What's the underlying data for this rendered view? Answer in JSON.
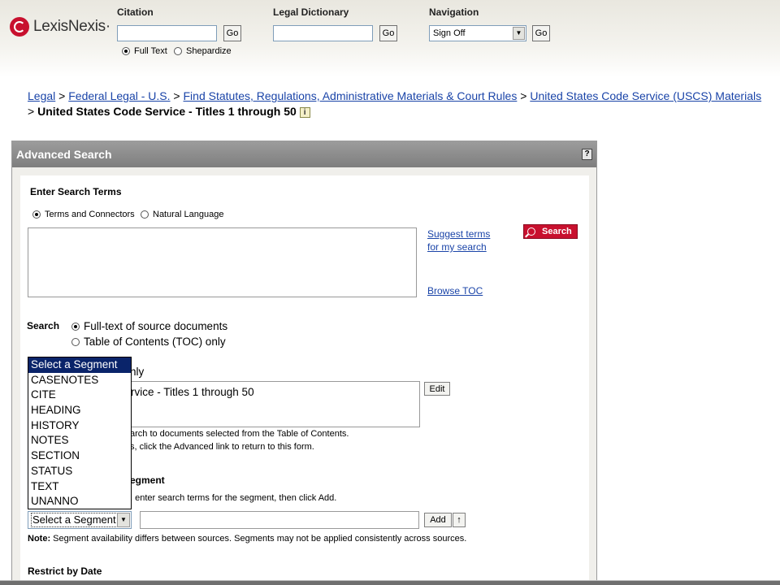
{
  "header": {
    "logo_text": "LexisNexis·",
    "citation": {
      "label": "Citation",
      "go": "Go",
      "value": ""
    },
    "citation_options": [
      {
        "label": "Full Text",
        "checked": true
      },
      {
        "label": "Shepardize",
        "checked": false
      }
    ],
    "dictionary": {
      "label": "Legal Dictionary",
      "go": "Go",
      "value": ""
    },
    "navigation": {
      "label": "Navigation",
      "selected": "Sign Off",
      "go": "Go"
    }
  },
  "breadcrumb": {
    "links": [
      "Legal",
      "Federal Legal - U.S.",
      "Find Statutes, Regulations, Administrative Materials & Court Rules",
      "United States Code Service (USCS) Materials"
    ],
    "separator": ">",
    "current": "United States Code Service - Titles 1 through 50",
    "info_icon": "i"
  },
  "panel": {
    "title": "Advanced Search",
    "help": "?",
    "enter_terms_label": "Enter Search Terms",
    "mode_options": [
      {
        "label": "Terms and Connectors",
        "checked": true
      },
      {
        "label": "Natural Language",
        "checked": false
      }
    ],
    "search_terms_value": "",
    "suggest_link_line1": "Suggest terms",
    "suggest_link_line2": "for my search",
    "browse_toc": "Browse TOC",
    "search_button": "Search",
    "search_label": "Search",
    "search_options": [
      {
        "label": "Full-text of source documents",
        "checked": true
      },
      {
        "label": "Table of Contents (TOC) only",
        "checked": false
      }
    ],
    "source_partial_label": "nly",
    "source_value": "rvice - Titles 1 through 50",
    "edit_button": "Edit",
    "note_line1": "arch to documents selected from the Table of Contents.",
    "note_line2": "s, click the Advanced link to return to this form.",
    "segment_partial_heading": "egment",
    "segment_instruction": ", enter search terms for the segment, then click Add.",
    "segment_select_value": "Select a Segment",
    "segment_term_value": "",
    "add_button": "Add",
    "up_arrow": "↑",
    "segment_note_bold": "Note:",
    "segment_note": " Segment availability differs between sources. Segments may not be applied consistently across sources.",
    "restrict_label": "Restrict by Date"
  },
  "segment_options": [
    "Select a Segment",
    "CASENOTES",
    "CITE",
    "HEADING",
    "HISTORY",
    "NOTES",
    "SECTION",
    "STATUS",
    "TEXT",
    "UNANNO"
  ]
}
